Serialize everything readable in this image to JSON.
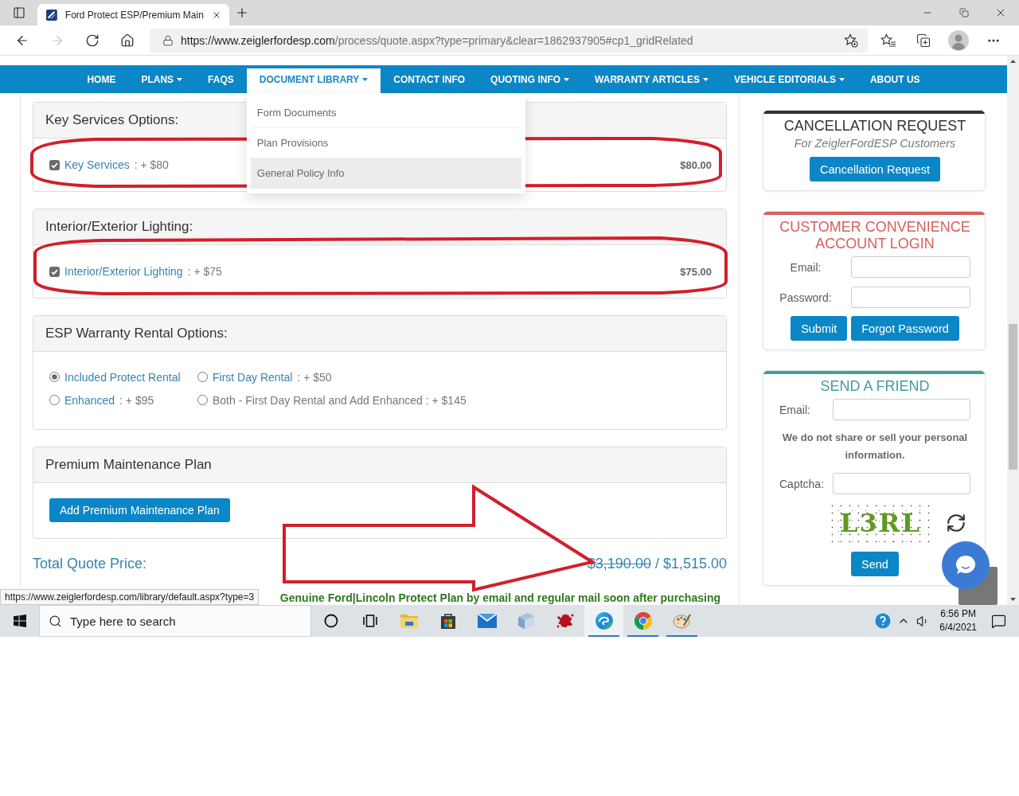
{
  "browser": {
    "tab": {
      "title": "Ford Protect ESP/Premium Main"
    },
    "nav_buttons": [
      {
        "kind": "back",
        "disabled": false
      },
      {
        "kind": "forward",
        "disabled": true
      },
      {
        "kind": "refresh",
        "disabled": false
      },
      {
        "kind": "home",
        "disabled": false
      }
    ],
    "address": {
      "host": "https://www.zeiglerfordesp.com",
      "path": "/process/quote.aspx?type=primary&clear=1862937905#cp1_gridRelated"
    }
  },
  "site_nav": {
    "items": [
      {
        "label": "HOME",
        "dropdown": false,
        "selected": false
      },
      {
        "label": "PLANS",
        "dropdown": true,
        "selected": false
      },
      {
        "label": "FAQS",
        "dropdown": false,
        "selected": false
      },
      {
        "label": "DOCUMENT LIBRARY",
        "dropdown": true,
        "selected": true
      },
      {
        "label": "CONTACT INFO",
        "dropdown": false,
        "selected": false
      },
      {
        "label": "QUOTING INFO",
        "dropdown": true,
        "selected": false
      },
      {
        "label": "WARRANTY ARTICLES",
        "dropdown": true,
        "selected": false
      },
      {
        "label": "VEHICLE EDITORIALS",
        "dropdown": true,
        "selected": false
      },
      {
        "label": "ABOUT US",
        "dropdown": false,
        "selected": false
      }
    ],
    "menu": {
      "items": [
        {
          "label": "Form Documents",
          "highlighted": false
        },
        {
          "label": "Plan Provisions",
          "highlighted": false
        },
        {
          "label": "General Policy Info",
          "highlighted": true
        }
      ]
    }
  },
  "panels": [
    {
      "kind": "checkbox",
      "heading": "Key Services Options:",
      "options": [
        {
          "label": "Key Services",
          "note": ": + $80",
          "linked": true,
          "checked": true,
          "amount": "$80.00"
        }
      ]
    },
    {
      "kind": "checkbox",
      "heading": "Interior/Exterior Lighting:",
      "options": [
        {
          "label": "Interior/Exterior Lighting",
          "note": ": + $75",
          "linked": true,
          "checked": true,
          "amount": "$75.00"
        }
      ]
    },
    {
      "kind": "radio",
      "heading": "ESP Warranty Rental Options:",
      "options": [
        {
          "label": "Included Protect Rental",
          "linked": true,
          "selected": true
        },
        {
          "label": "First Day Rental",
          "note": ": + $50",
          "linked": true,
          "selected": false
        },
        {
          "label": "Enhanced",
          "note": ": + $95",
          "linked": true,
          "selected": false
        },
        {
          "label": "Both - First Day Rental and Add Enhanced : + $145",
          "linked": false,
          "selected": false
        }
      ]
    },
    {
      "kind": "button",
      "heading": "Premium Maintenance Plan",
      "button": "Add Premium Maintenance Plan"
    }
  ],
  "total": {
    "label": "Total Quote Price:",
    "original_price": "$3,190.00",
    "price": "/ $1,515.00"
  },
  "notice": "Genuine Ford|Lincoln Protect Plan by email and regular mail soon after purchasing",
  "sidebar": {
    "cards": [
      {
        "kind": "promo",
        "color": "#2e3236",
        "title": "CANCELLATION REQUEST",
        "subtitle": "For ZeiglerFordESP Customers",
        "rows": [
          {
            "kind": "buttons",
            "buttons": [
              "Cancellation Request"
            ]
          }
        ]
      },
      {
        "kind": "login",
        "color": "#d6605d",
        "title": "CUSTOMER CONVENIENCE ACCOUNT LOGIN",
        "rows": [
          {
            "kind": "field",
            "label": "Email:"
          },
          {
            "kind": "field",
            "label": "Password:"
          },
          {
            "kind": "buttons",
            "buttons": [
              "Submit",
              "Forgot Password"
            ]
          }
        ]
      },
      {
        "kind": "share",
        "color": "#3f9fa1",
        "title": "SEND A FRIEND",
        "rows": [
          {
            "kind": "field",
            "label": "Email:"
          },
          {
            "kind": "note",
            "text": "We do not share or sell your personal information."
          },
          {
            "kind": "field",
            "label": "Captcha:"
          },
          {
            "kind": "captcha",
            "text": "L3RL"
          },
          {
            "kind": "buttons",
            "buttons": [
              "Send"
            ]
          }
        ]
      }
    ]
  },
  "status_url": "https://www.zeiglerfordesp.com/library/default.aspx?type=3",
  "taskbar": {
    "search": {
      "placeholder": "Type here to search"
    },
    "apps": [
      {
        "kind": "ring",
        "running": false,
        "active": false
      },
      {
        "kind": "task_view",
        "running": false,
        "active": false
      },
      {
        "kind": "folder",
        "running": false,
        "active": false
      },
      {
        "kind": "bag",
        "running": false,
        "active": false
      },
      {
        "kind": "mail",
        "running": false,
        "active": false
      },
      {
        "kind": "cube",
        "running": false,
        "active": false
      },
      {
        "kind": "splat",
        "running": false,
        "active": false
      },
      {
        "kind": "swirl",
        "running": true,
        "active": true
      },
      {
        "kind": "orb",
        "running": true,
        "active": false
      },
      {
        "kind": "palette",
        "running": true,
        "active": false
      }
    ],
    "time": "6:56 PM",
    "date": "6/4/2021"
  }
}
